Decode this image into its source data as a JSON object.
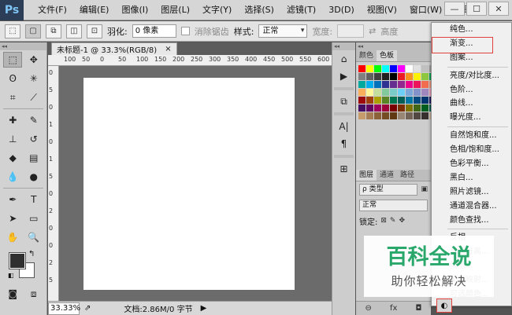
{
  "app": {
    "logo_text": "Ps",
    "menu": [
      "文件(F)",
      "编辑(E)",
      "图像(I)",
      "图层(L)",
      "文字(Y)",
      "选择(S)",
      "滤镜(T)",
      "3D(D)",
      "视图(V)",
      "窗口(W)",
      "帮助(H)"
    ],
    "window_controls": {
      "minimize": "—",
      "restore": "☐",
      "close": "✕"
    }
  },
  "options_bar": {
    "feather_label": "羽化:",
    "feather_value": "0 像素",
    "antialias_label": "消除锯齿",
    "style_label": "样式:",
    "style_value": "正常",
    "width_label": "宽度:",
    "height_label": "高度"
  },
  "document": {
    "tab_title": "未标题-1 @ 33.3%(RGB/8)",
    "tab_close": "×",
    "ruler_top_ticks": [
      "100",
      "50",
      "0",
      "50",
      "100",
      "150",
      "200",
      "250",
      "300",
      "350",
      "400",
      "450",
      "500",
      "550",
      "600",
      "650"
    ],
    "ruler_left_ticks": [
      "0",
      "5",
      "0",
      "1",
      "0",
      "1",
      "5",
      "0",
      "2",
      "0",
      "0",
      "2",
      "5"
    ],
    "zoom": "33.33%",
    "doc_info": "文档:2.86M/0 字节",
    "status_arrow": "▶"
  },
  "panels": {
    "swatch_tabs": [
      "颜色",
      "色板"
    ],
    "layer_tabs": [
      "图层",
      "通道",
      "路径"
    ],
    "filter_placeholder": "ρ 类型",
    "blend_mode": "正常",
    "lock_label": "锁定:",
    "swatch_colors": [
      "#ff0000",
      "#ffff00",
      "#00ff00",
      "#00ffff",
      "#0000ff",
      "#ff00ff",
      "#ffffff",
      "#e0e0e0",
      "#c0c0c0",
      "#a0a0a0",
      "#808080",
      "#606060",
      "#404040",
      "#202020",
      "#000000",
      "#ed1c24",
      "#f7941d",
      "#fff200",
      "#8dc63f",
      "#00a651",
      "#00a99d",
      "#00aeef",
      "#0072bc",
      "#2e3192",
      "#662d91",
      "#92278f",
      "#ec008c",
      "#ed145b",
      "#f26c4f",
      "#f69679",
      "#fbaf5d",
      "#fff799",
      "#c4df9b",
      "#82ca9c",
      "#7accc8",
      "#6dcff6",
      "#7da7d9",
      "#8393ca",
      "#a187be",
      "#f49ac1",
      "#9e0b0f",
      "#a0410d",
      "#aba000",
      "#598527",
      "#00734f",
      "#005e56",
      "#0076a3",
      "#004a80",
      "#003471",
      "#1b1464",
      "#440e62",
      "#630460",
      "#9e005d",
      "#9e0039",
      "#790000",
      "#7b2e00",
      "#7d7100",
      "#406618",
      "#005e20",
      "#005952",
      "#c69c6d",
      "#a67c52",
      "#8c6239",
      "#754c24",
      "#603913",
      "#998675",
      "#736357",
      "#534741",
      "#362f2d",
      "#c7b299"
    ]
  },
  "adjust_menu": {
    "items": [
      "纯色...",
      "渐变...",
      "图案...",
      "亮度/对比度...",
      "色阶...",
      "曲线...",
      "曝光度...",
      "自然饱和度...",
      "色相/饱和度...",
      "色彩平衡...",
      "黑白...",
      "照片滤镜...",
      "通道混合器...",
      "颜色查找...",
      "反相",
      "色调分离...",
      "阈值...",
      "渐变映射...",
      "可选颜色..."
    ],
    "highlighted_item": "渐变..."
  },
  "watermark": {
    "title": "百科全说",
    "subtitle": "助你轻松解决"
  },
  "colors": {
    "highlight": "#e0413c",
    "watermark_green": "#2aa86b"
  }
}
